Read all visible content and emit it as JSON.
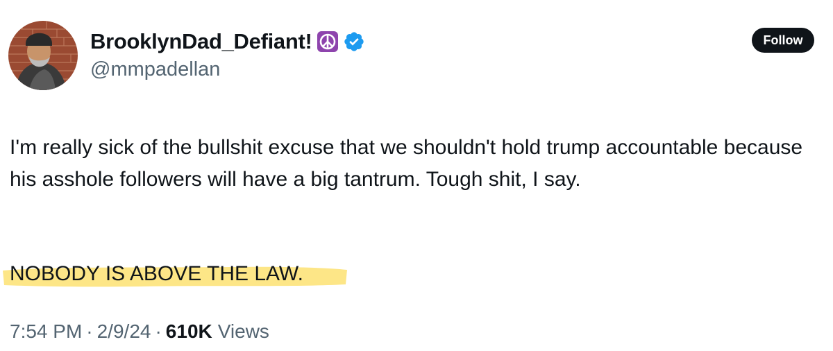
{
  "author": {
    "display_name": "BrooklynDad_Defiant!",
    "handle": "@mmpadellan",
    "name_emoji": "peace-symbol-emoji",
    "verified_icon": "verified-badge-icon",
    "verified_color": "#1d9bf0",
    "peace_emoji_color": "#8e44ad"
  },
  "follow_button": {
    "label": "Follow",
    "background": "#0f1419",
    "text_color": "#ffffff"
  },
  "tweet": {
    "body": "I'm really sick of the bullshit excuse that we shouldn't hold trump accountable because his asshole followers will have a big tantrum. Tough shit, I say.",
    "emphasis": "NOBODY IS ABOVE THE LAW.",
    "highlight_color": "#fde37a"
  },
  "meta": {
    "time": "7:54 PM",
    "separator": "·",
    "date": "2/9/24",
    "views_count": "610K",
    "views_label": "Views"
  }
}
